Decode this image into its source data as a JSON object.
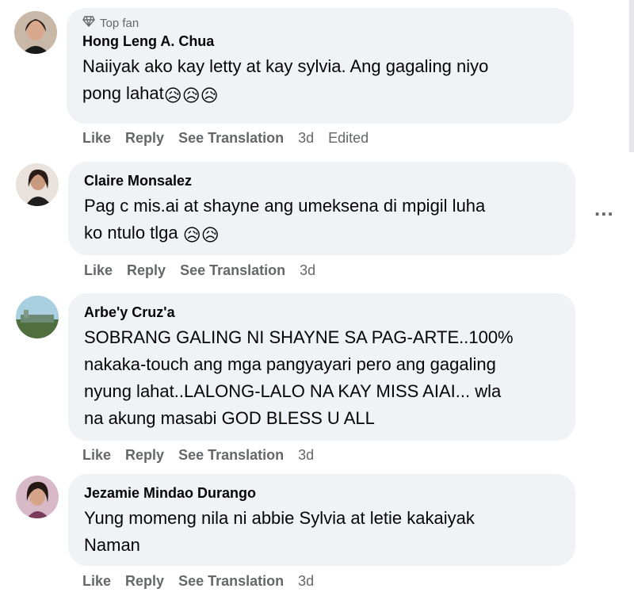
{
  "comments": [
    {
      "badge": "Top fan",
      "author": "Hong Leng A. Chua",
      "text_line1": "Naiiyak ako kay letty at kay sylvia. Ang gagaling niyo",
      "text_line2": "pong lahat",
      "emoji": "😥😥😥",
      "like": "Like",
      "reply": "Reply",
      "translate": "See Translation",
      "time": "3d",
      "edited": "Edited"
    },
    {
      "author": "Claire Monsalez",
      "text_line1": "Pag c mis.ai at shayne ang umeksena di mpigil luha",
      "text_line2": "ko ntulo tlga",
      "emoji": "😥😥",
      "like": "Like",
      "reply": "Reply",
      "translate": "See Translation",
      "time": "3d",
      "more": "..."
    },
    {
      "author": "Arbe'y Cruz'a",
      "text_line1": "SOBRANG GALING NI SHAYNE SA PAG-ARTE..100%",
      "text_line2": "nakaka-touch ang mga pangyayari pero ang gagaling",
      "text_line3": "nyung lahat..LALONG-LALO NA KAY MISS AIAI... wla",
      "text_line4": "na akung masabi GOD BLESS U ALL",
      "like": "Like",
      "reply": "Reply",
      "translate": "See Translation",
      "time": "3d"
    },
    {
      "author": "Jezamie Mindao Durango",
      "text_line1": "Yung momeng nila ni abbie Sylvia at letie kakaiyak",
      "text_line2": "Naman",
      "like": "Like",
      "reply": "Reply",
      "translate": "See Translation",
      "time": "3d"
    }
  ],
  "colors": {
    "bubble": "#f0f2f5",
    "meta_text": "#65676b",
    "body_text": "#050505"
  }
}
